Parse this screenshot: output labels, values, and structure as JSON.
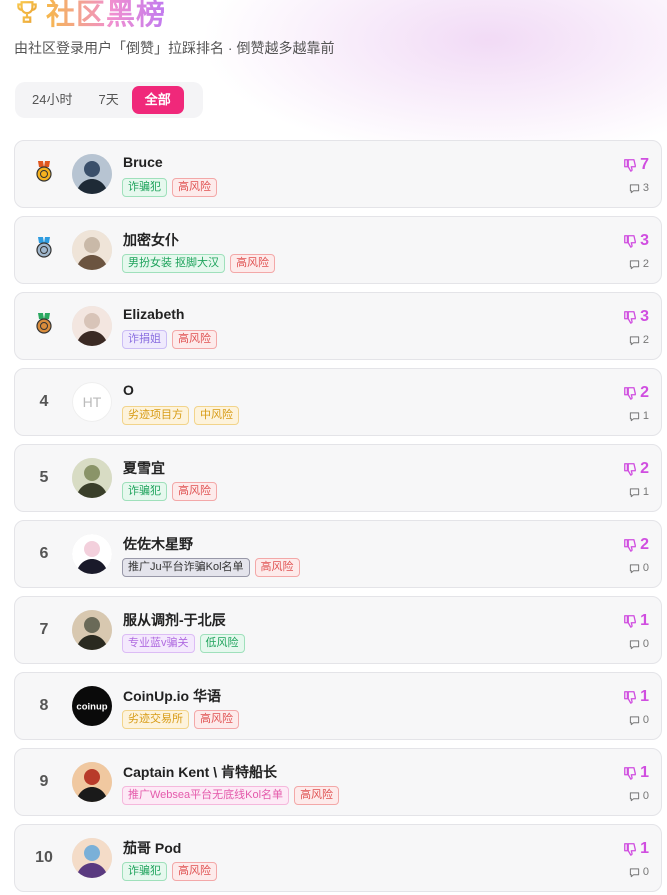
{
  "page": {
    "title": "社区黑榜",
    "subtitle": "由社区登录用户「倒赞」拉踩排名 · 倒赞越多越靠前",
    "trophy_icon": "trophy-icon"
  },
  "tabs": [
    {
      "label": "24小时",
      "active": false
    },
    {
      "label": "7天",
      "active": false
    },
    {
      "label": "全部",
      "active": true
    }
  ],
  "colors": {
    "accent": "#f0287a",
    "vote": "#d04ee0",
    "title_gradient": [
      "#f6b84a",
      "#f08fd0",
      "#c07af0"
    ]
  },
  "entries": [
    {
      "rank": "",
      "medal": "gold",
      "name": "Bruce",
      "avatar": "photo",
      "tags": [
        {
          "text": "诈骗犯",
          "style": "green"
        },
        {
          "text": "高风险",
          "style": "red"
        }
      ],
      "downvotes": "7",
      "comments": "3"
    },
    {
      "rank": "",
      "medal": "silver",
      "name": "加密女仆",
      "avatar": "photo",
      "tags": [
        {
          "text": "男扮女装 抠脚大汉",
          "style": "green"
        },
        {
          "text": "高风险",
          "style": "red"
        }
      ],
      "downvotes": "3",
      "comments": "2"
    },
    {
      "rank": "",
      "medal": "bronze",
      "name": "Elizabeth",
      "avatar": "photo",
      "tags": [
        {
          "text": "诈捐姐",
          "style": "purple"
        },
        {
          "text": "高风险",
          "style": "red"
        }
      ],
      "downvotes": "3",
      "comments": "2"
    },
    {
      "rank": "4",
      "medal": "",
      "name": "O",
      "avatar": "HT",
      "tags": [
        {
          "text": "劣迹项目方",
          "style": "amber"
        },
        {
          "text": "中风险",
          "style": "amber"
        }
      ],
      "downvotes": "2",
      "comments": "1"
    },
    {
      "rank": "5",
      "medal": "",
      "name": "夏雪宜",
      "avatar": "photo",
      "tags": [
        {
          "text": "诈骗犯",
          "style": "green"
        },
        {
          "text": "高风险",
          "style": "red"
        }
      ],
      "downvotes": "2",
      "comments": "1"
    },
    {
      "rank": "6",
      "medal": "",
      "name": "佐佐木星野",
      "avatar": "photo",
      "tags": [
        {
          "text": "推广Ju平台诈骗Kol名单",
          "style": "dark"
        },
        {
          "text": "高风险",
          "style": "red"
        }
      ],
      "downvotes": "2",
      "comments": "0"
    },
    {
      "rank": "7",
      "medal": "",
      "name": "服从调剂-于北辰",
      "avatar": "photo",
      "tags": [
        {
          "text": "专业蓝v骗关",
          "style": "violet"
        },
        {
          "text": "低风险",
          "style": "green"
        }
      ],
      "downvotes": "1",
      "comments": "0"
    },
    {
      "rank": "8",
      "medal": "",
      "name": "CoinUp.io 华语",
      "avatar": "coinup",
      "tags": [
        {
          "text": "劣迹交易所",
          "style": "amber"
        },
        {
          "text": "高风险",
          "style": "red"
        }
      ],
      "downvotes": "1",
      "comments": "0"
    },
    {
      "rank": "9",
      "medal": "",
      "name": "Captain Kent \\ 肯特船长",
      "avatar": "photo",
      "tags": [
        {
          "text": "推广Websea平台无底线Kol名单",
          "style": "pink"
        },
        {
          "text": "高风险",
          "style": "red"
        }
      ],
      "downvotes": "1",
      "comments": "0"
    },
    {
      "rank": "10",
      "medal": "",
      "name": "茄哥 Pod",
      "avatar": "photo",
      "tags": [
        {
          "text": "诈骗犯",
          "style": "green"
        },
        {
          "text": "高风险",
          "style": "red"
        }
      ],
      "downvotes": "1",
      "comments": "0"
    }
  ]
}
